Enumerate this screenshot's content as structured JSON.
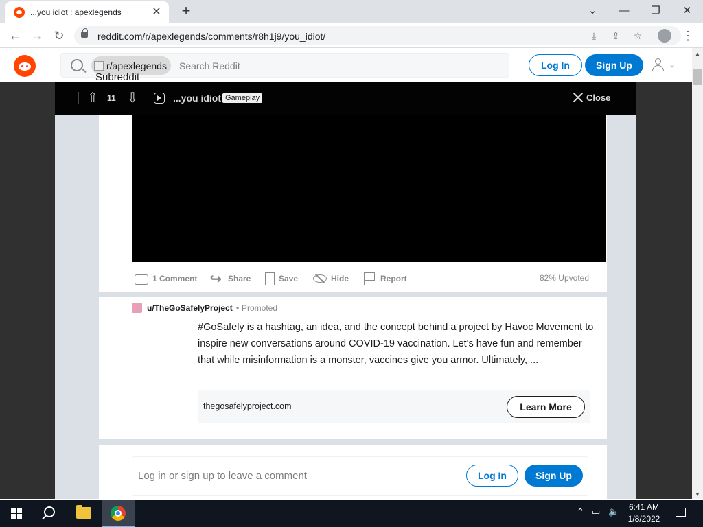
{
  "browser": {
    "tab_title": "...you idiot : apexlegends",
    "tab_close": "✕",
    "new_tab": "+",
    "url": "reddit.com/r/apexlegends/comments/r8h1j9/you_idiot/",
    "win_minimize": "—",
    "win_restore": "❐",
    "win_close": "✕",
    "chevron": "⌄"
  },
  "header": {
    "subreddit_chip": "r/apexlegends",
    "subreddit_alt": "Subreddit",
    "search_placeholder": "Search Reddit",
    "login_label": "Log In",
    "signup_label": "Sign Up"
  },
  "post": {
    "vote_count": "11",
    "title": "...you idiot",
    "flair": "Gameplay",
    "close_label": "Close",
    "actions": {
      "comments": "1 Comment",
      "share": "Share",
      "save": "Save",
      "hide": "Hide",
      "report": "Report"
    },
    "upvoted": "82% Upvoted"
  },
  "promoted": {
    "user": "u/TheGoSafelyProject",
    "separator": "•",
    "tag": "Promoted",
    "body": "#GoSafely is a hashtag, an idea, and the concept behind a project by Havoc Movement to inspire new conversations around COVID-19 vaccination. Let's have fun and remember that while misinformation is a monster, vaccines give you armor. Ultimately, ...",
    "domain": "thegosafelyproject.com",
    "cta": "Learn More"
  },
  "comment_box": {
    "prompt": "Log in or sign up to leave a comment",
    "login_label": "Log In",
    "signup_label": "Sign Up"
  },
  "taskbar": {
    "time": "6:41 AM",
    "date": "1/8/2022"
  },
  "colors": {
    "reddit_orange": "#ff4500",
    "reddit_blue": "#0079d3",
    "overlay_bg": "#303030",
    "post_bar_bg": "#030303"
  }
}
